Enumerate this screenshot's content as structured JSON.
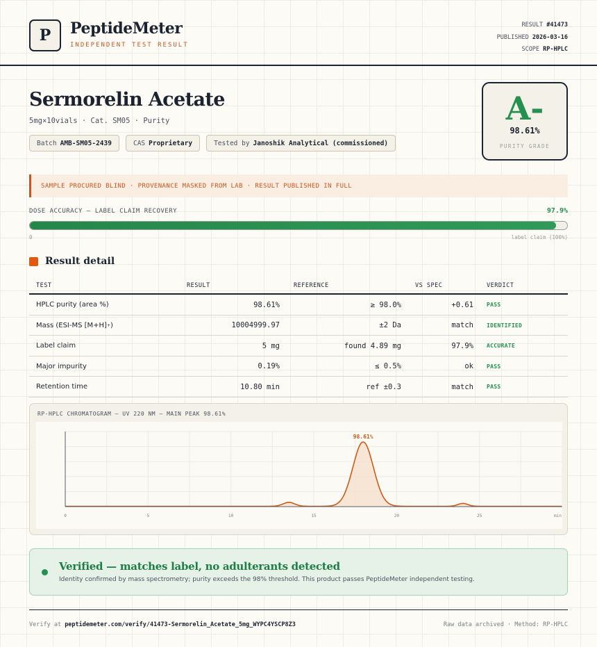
{
  "brand": {
    "logo_letter": "P",
    "name": "PeptideMeter",
    "tagline": "INDEPENDENT TEST RESULT"
  },
  "meta": {
    "result_label": "RESULT",
    "result_value": "#41473",
    "published_label": "PUBLISHED",
    "published_value": "2026-03-16",
    "scope_label": "SCOPE",
    "scope_value": "RP-HPLC"
  },
  "product": {
    "title": "Sermorelin Acetate",
    "subtitle": "5mg×10vials · Cat. SM05 · Purity",
    "chips": [
      {
        "label": "Batch",
        "value": "AMB-SM05-2439"
      },
      {
        "label": "CAS",
        "value": "Proprietary"
      },
      {
        "label": "Tested by",
        "value": "Janoshik Analytical (commissioned)"
      }
    ]
  },
  "grade": {
    "letter": "A-",
    "value": "98.61%",
    "label": "PURITY GRADE",
    "color": "#259050"
  },
  "banner": {
    "text": "SAMPLE PROCURED BLIND · PROVENANCE MASKED FROM LAB · RESULT PUBLISHED IN FULL"
  },
  "dose": {
    "label": "DOSE ACCURACY — LABEL CLAIM RECOVERY",
    "value_text": "97.9%",
    "fraction": 0.979,
    "min_label": "0",
    "max_label": "label claim (100%)"
  },
  "section": {
    "title": "Result detail"
  },
  "table": {
    "headers": [
      "TEST",
      "RESULT",
      "REFERENCE",
      "VS SPEC",
      "VERDICT"
    ],
    "rows": [
      {
        "test": "HPLC purity (area %)",
        "result": "98.61%",
        "reference": "≥ 98.0%",
        "spec": "+0.61",
        "verdict": "PASS"
      },
      {
        "test": "Mass (ESI-MS [M+H]",
        "test_sup": "+",
        "test_end": ")",
        "result": "10004999.97",
        "reference": "±2 Da",
        "spec": "match",
        "verdict": "IDENTIFIED"
      },
      {
        "test": "Label claim",
        "result": "5 mg",
        "reference": "found 4.89 mg",
        "spec": "97.9%",
        "verdict": "ACCURATE"
      },
      {
        "test": "Major impurity",
        "result": "0.19%",
        "reference": "≤ 0.5%",
        "spec": "ok",
        "verdict": "PASS"
      },
      {
        "test": "Retention time",
        "result": "10.80 min",
        "reference": "ref ±0.3",
        "spec": "match",
        "verdict": "PASS"
      }
    ]
  },
  "chart_data": {
    "type": "line",
    "title": "RP-HPLC CHROMATOGRAM — UV 220 NM — MAIN PEAK 98.61%",
    "xlabel": "",
    "ylabel": "",
    "x_ticks": [
      0,
      5,
      10,
      15,
      20,
      25
    ],
    "x_tick_labels": [
      "0",
      "5",
      "10",
      "15",
      "20",
      "25"
    ],
    "x_end_label": "min",
    "xlim": [
      0,
      30
    ],
    "ylim": [
      0,
      1.05
    ],
    "peaks": [
      {
        "rt": 13.5,
        "height": 0.055,
        "width": 0.35
      },
      {
        "rt": 17.98,
        "height": 0.9,
        "width": 0.62
      },
      {
        "rt": 24.0,
        "height": 0.04,
        "width": 0.3
      }
    ],
    "baseline": 0.005,
    "annotation": {
      "text": "98.61%",
      "x": 17.98
    },
    "line_color": "#cc5b18",
    "fill_color": "#f6e1cf",
    "grid": true
  },
  "verified": {
    "title": "Verified — matches label, no adulterants detected",
    "text": "Identity confirmed by mass spectrometry; purity exceeds the 98% threshold. This product passes PeptideMeter independent testing."
  },
  "footer": {
    "verify_prefix": "Verify at",
    "verify_url": "peptidemeter.com/verify/41473-Sermorelin_Acetate_5mg_WYPC4YSCP8Z3",
    "right_text": "Raw data archived · Method: RP-HPLC"
  }
}
